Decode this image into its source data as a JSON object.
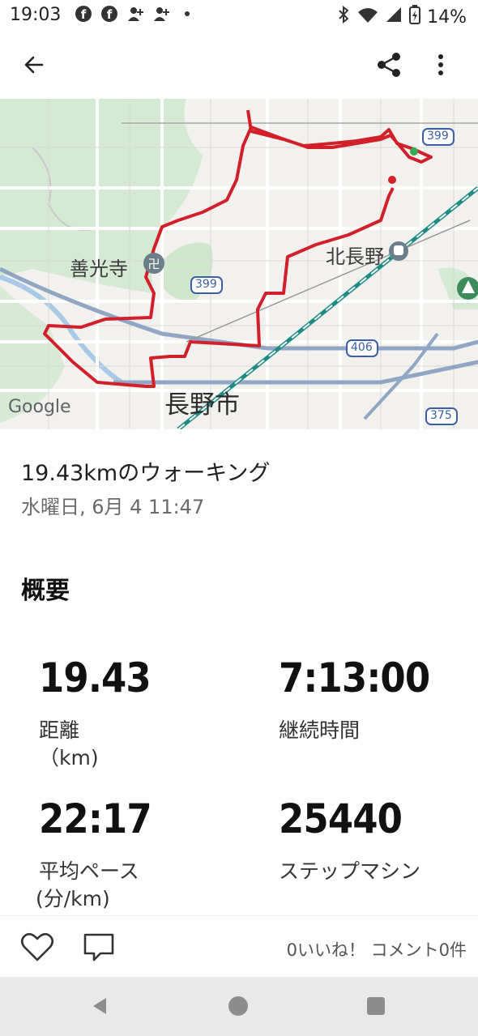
{
  "status_bar": {
    "time": "19:03",
    "battery": "14%",
    "notification_icons": [
      "facebook-icon",
      "facebook-icon",
      "add-person-icon",
      "add-person-icon",
      "dot-icon"
    ],
    "system_icons": [
      "bluetooth-icon",
      "wifi-icon",
      "signal-icon",
      "battery-icon"
    ]
  },
  "app_bar": {
    "back_icon": "arrow-left-icon",
    "share_icon": "share-icon",
    "menu_icon": "more-vert-icon"
  },
  "map": {
    "labels": {
      "zenkoji": "善光寺",
      "kita_nagano": "北長野",
      "nagano_city": "長野市",
      "route_399_a": "399",
      "route_399_b": "399",
      "route_406": "406",
      "route_375": "375",
      "google": "Google"
    },
    "route_color": "#d1202a"
  },
  "activity": {
    "title": "19.43kmのウォーキング",
    "datetime": "水曜日, 6月 4 11:47"
  },
  "summary": {
    "heading": "概要",
    "stats": [
      {
        "value": "19.43",
        "label": "距離",
        "unit": "（km)"
      },
      {
        "value": "7:13:00",
        "label": "継続時間"
      },
      {
        "value": "22:17",
        "label": "平均ペース",
        "unit": "(分/km)"
      },
      {
        "value": "25440",
        "label": "ステップマシン"
      }
    ]
  },
  "actions": {
    "like_icon": "heart-icon",
    "comment_icon": "comment-icon",
    "counts": "0いいね！ コメント0件"
  },
  "nav": {
    "back": "triangle-back-icon",
    "home": "circle-home-icon",
    "recents": "square-recents-icon"
  }
}
